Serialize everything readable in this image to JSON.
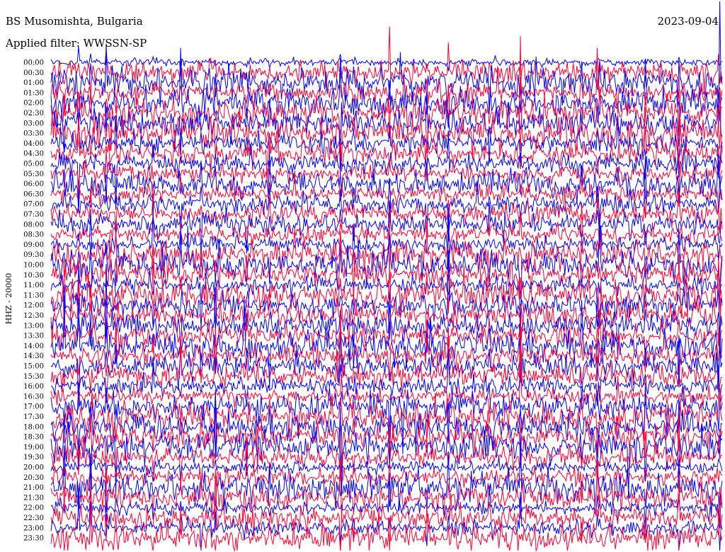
{
  "header": {
    "title": "BS Musomishta, Bulgaria",
    "subtitle": "Applied filter: WWSSN-SP",
    "date": "2023-09-04"
  },
  "chart_data": {
    "type": "line",
    "title": "BS Musomishta, Bulgaria",
    "subtitle": "Applied filter: WWSSN-SP",
    "ylabel": "HHZ - 20000",
    "xlabel": "",
    "y_tick_labels": [
      "00:00",
      "00:30",
      "01:00",
      "01:30",
      "02:00",
      "02:30",
      "03:00",
      "03:30",
      "04:00",
      "04:30",
      "05:00",
      "05:30",
      "06:00",
      "06:30",
      "07:00",
      "07:30",
      "08:00",
      "08:30",
      "09:00",
      "09:30",
      "10:00",
      "10:30",
      "11:00",
      "11:30",
      "12:00",
      "12:30",
      "13:00",
      "13:30",
      "14:00",
      "14:30",
      "15:00",
      "15:30",
      "16:00",
      "16:30",
      "17:00",
      "17:30",
      "18:00",
      "18:30",
      "19:00",
      "19:30",
      "20:00",
      "20:30",
      "21:00",
      "21:30",
      "22:00",
      "22:30",
      "23:00",
      "23:30"
    ],
    "trace_colors": [
      "#0000ff",
      "#ff0033"
    ],
    "trace_color_pattern": "alternating",
    "grid": false,
    "legend": "none"
  }
}
